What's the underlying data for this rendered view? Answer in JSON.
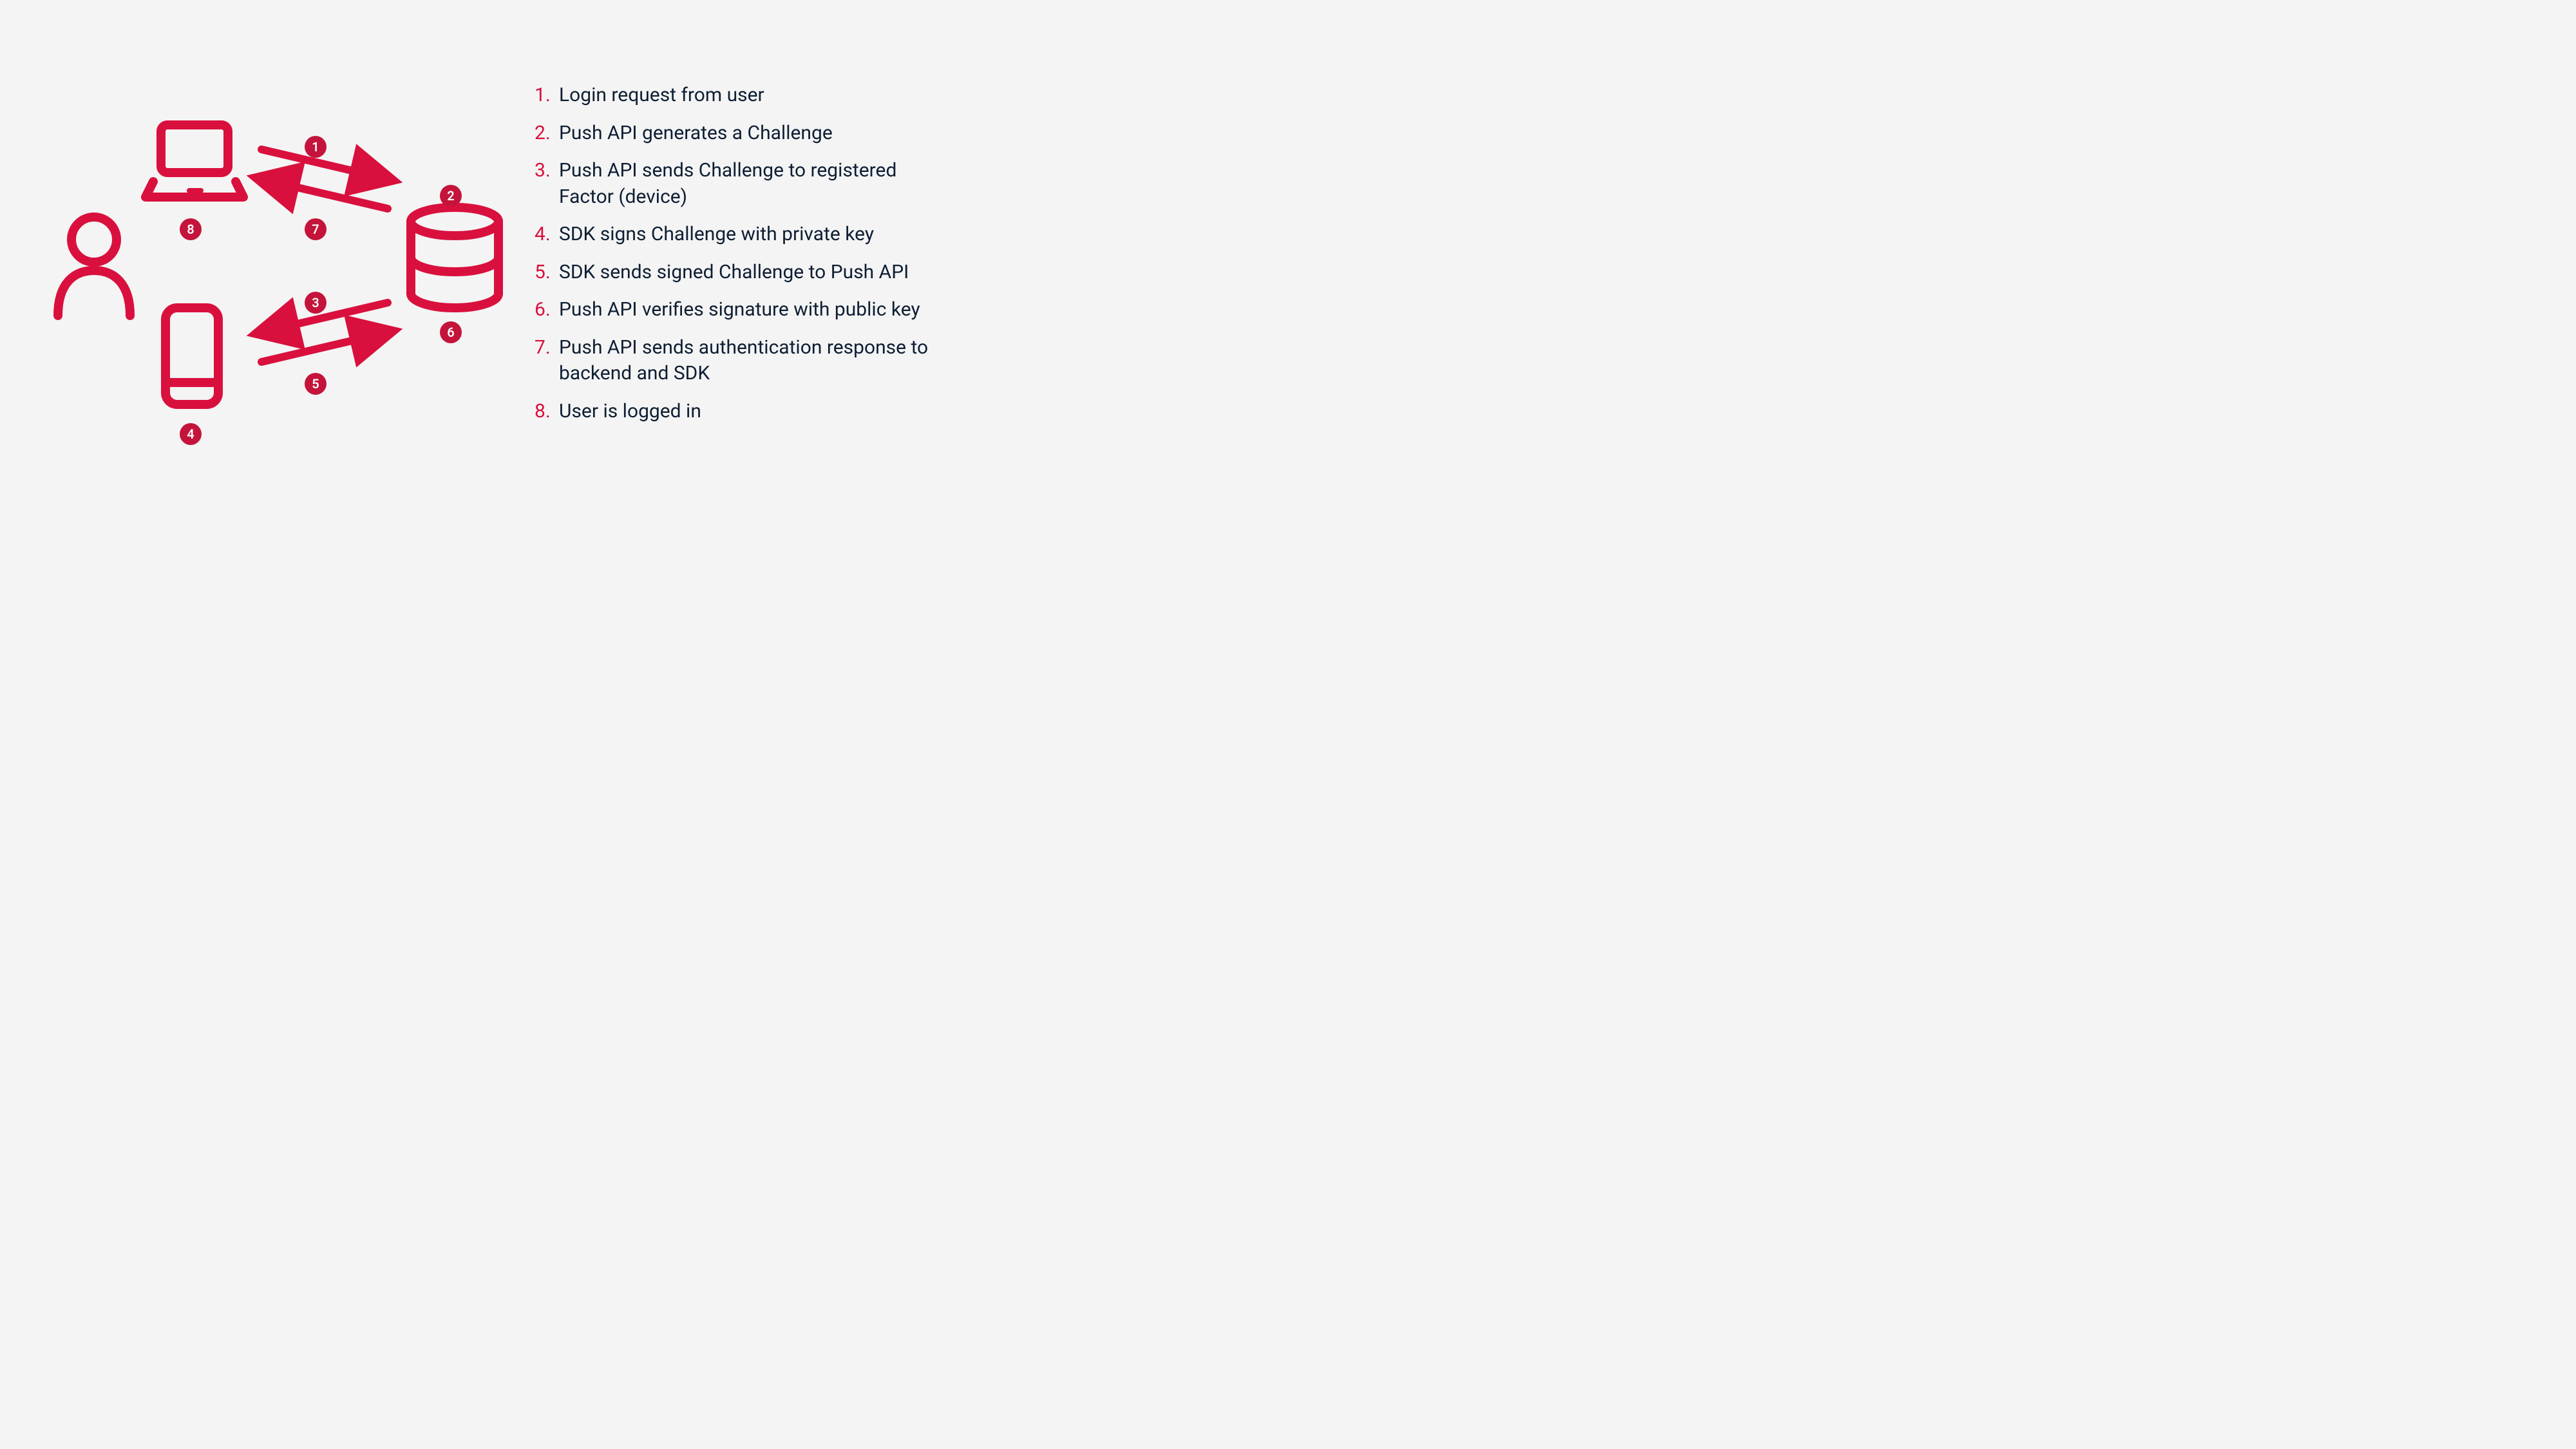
{
  "colors": {
    "accent": "#d9103d",
    "badge": "#c4143b",
    "text": "#0e1e33",
    "background": "#f4f4f4"
  },
  "diagram_badges": {
    "b1": "1",
    "b2": "2",
    "b3": "3",
    "b4": "4",
    "b5": "5",
    "b6": "6",
    "b7": "7",
    "b8": "8"
  },
  "legend": [
    {
      "num": "1.",
      "text": "Login request from user"
    },
    {
      "num": "2.",
      "text": "Push API generates a Challenge"
    },
    {
      "num": "3.",
      "text": "Push API sends Challenge to registered Factor (device)"
    },
    {
      "num": "4.",
      "text": "SDK signs Challenge with private key"
    },
    {
      "num": "5.",
      "text": "SDK sends signed Challenge to Push API"
    },
    {
      "num": "6.",
      "text": "Push API verifies signature with public key"
    },
    {
      "num": "7.",
      "text": "Push API sends authentication response to backend and SDK"
    },
    {
      "num": "8.",
      "text": "User is logged in"
    }
  ],
  "nodes": {
    "user": "user-icon",
    "laptop": "laptop-icon",
    "phone": "phone-icon",
    "database": "database-icon"
  }
}
